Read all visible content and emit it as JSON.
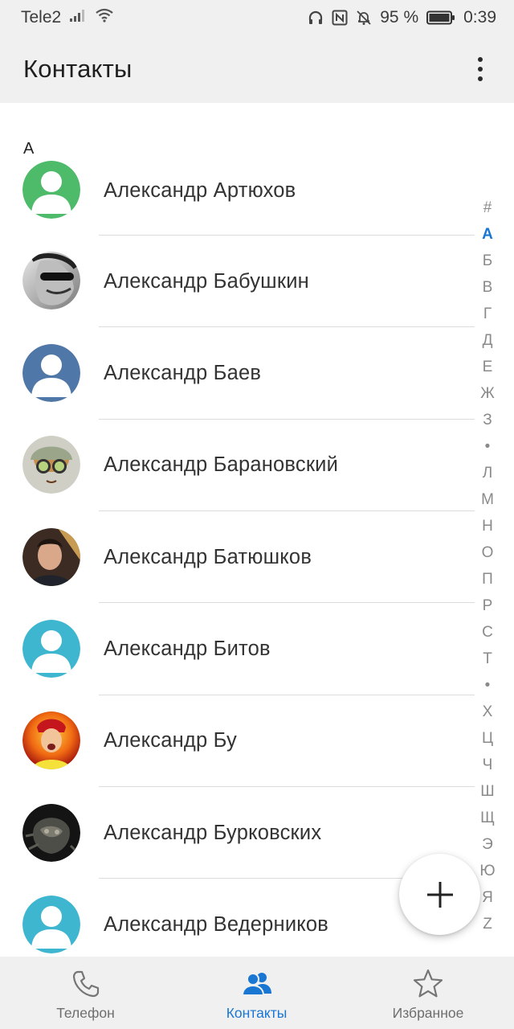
{
  "status_bar": {
    "carrier": "Tele2",
    "battery_percent": "95 %",
    "time": "0:39"
  },
  "app_bar": {
    "title": "Контакты"
  },
  "section_header": "А",
  "contacts": [
    {
      "name": "Александр Артюхов",
      "avatar": "placeholder-green"
    },
    {
      "name": "Александр Бабушкин",
      "avatar": "photo-sunglasses"
    },
    {
      "name": "Александр Баев",
      "avatar": "placeholder-steelblue"
    },
    {
      "name": "Александр Барановский",
      "avatar": "photo-cat"
    },
    {
      "name": "Александр Батюшков",
      "avatar": "photo-portrait"
    },
    {
      "name": "Александр Битов",
      "avatar": "placeholder-cyan"
    },
    {
      "name": "Александр Бу",
      "avatar": "photo-fire"
    },
    {
      "name": "Александр Бурковских",
      "avatar": "photo-dark"
    },
    {
      "name": "Александр Ведерников",
      "avatar": "placeholder-cyan"
    }
  ],
  "alphabet_index": [
    "#",
    "А",
    "Б",
    "В",
    "Г",
    "Д",
    "Е",
    "Ж",
    "З",
    "•",
    "Л",
    "М",
    "Н",
    "О",
    "П",
    "Р",
    "С",
    "Т",
    "•",
    "Х",
    "Ц",
    "Ч",
    "Ш",
    "Щ",
    "Э",
    "Ю",
    "Я",
    "Z"
  ],
  "alphabet_active": "А",
  "bottom_nav": [
    {
      "label": "Телефон",
      "icon": "phone-icon"
    },
    {
      "label": "Контакты",
      "icon": "people-icon",
      "active": true
    },
    {
      "label": "Избранное",
      "icon": "star-icon"
    }
  ],
  "colors": {
    "accent": "#1976d2",
    "avatar_green": "#4dbb6a",
    "avatar_steelblue": "#4f77a8",
    "avatar_cyan": "#3fb6cf"
  }
}
